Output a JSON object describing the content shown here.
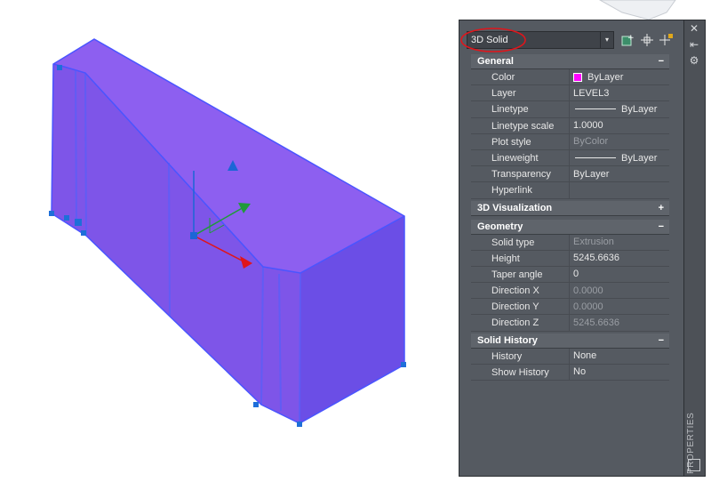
{
  "selector": {
    "value": "3D Solid",
    "arrow": "▾"
  },
  "strip": {
    "close": "✕",
    "autohide": "⇤",
    "settings": "⚙",
    "title": "PROPERTIES"
  },
  "sections": {
    "general": {
      "title": "General",
      "toggle": "−",
      "rows": [
        {
          "label": "Color",
          "value": "ByLayer"
        },
        {
          "label": "Layer",
          "value": "LEVEL3"
        },
        {
          "label": "Linetype",
          "value": "ByLayer"
        },
        {
          "label": "Linetype scale",
          "value": "1.0000"
        },
        {
          "label": "Plot style",
          "value": "ByColor"
        },
        {
          "label": "Lineweight",
          "value": "ByLayer"
        },
        {
          "label": "Transparency",
          "value": "ByLayer"
        },
        {
          "label": "Hyperlink",
          "value": ""
        }
      ]
    },
    "visualization": {
      "title": "3D Visualization",
      "toggle": "+"
    },
    "geometry": {
      "title": "Geometry",
      "toggle": "−",
      "rows": [
        {
          "label": "Solid type",
          "value": "Extrusion"
        },
        {
          "label": "Height",
          "value": "5245.6636"
        },
        {
          "label": "Taper angle",
          "value": "0"
        },
        {
          "label": "Direction X",
          "value": "0.0000"
        },
        {
          "label": "Direction Y",
          "value": "0.0000"
        },
        {
          "label": "Direction Z",
          "value": "5245.6636"
        }
      ]
    },
    "history": {
      "title": "Solid History",
      "toggle": "−",
      "rows": [
        {
          "label": "History",
          "value": "None"
        },
        {
          "label": "Show History",
          "value": "No"
        }
      ]
    }
  },
  "colors": {
    "solid_face": "#8358ea",
    "solid_edge": "#4a55ff",
    "highlight": "#e0151b",
    "grip": "#1e6fd9",
    "palette_bg": "#555a61"
  }
}
